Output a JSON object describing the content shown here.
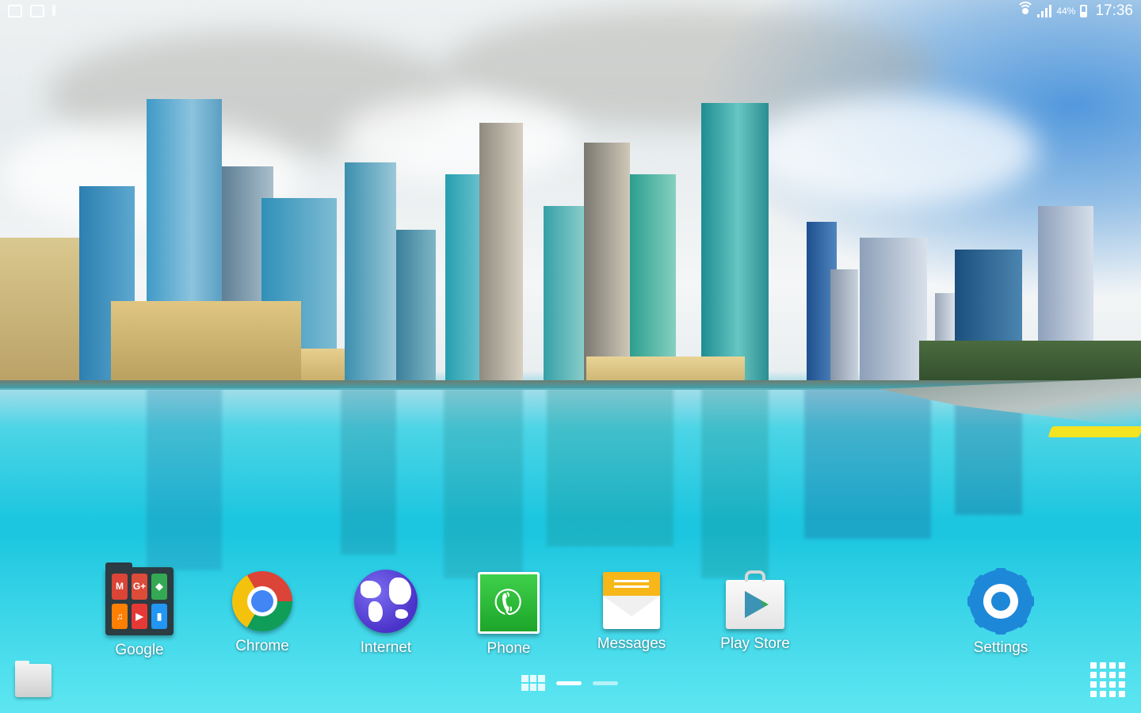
{
  "status_bar": {
    "battery_percent": "44%",
    "time": "17:36"
  },
  "dock": {
    "apps": [
      {
        "label": "Google"
      },
      {
        "label": "Chrome"
      },
      {
        "label": "Internet"
      },
      {
        "label": "Phone"
      },
      {
        "label": "Messages"
      },
      {
        "label": "Play Store"
      },
      {
        "label": "Settings"
      }
    ]
  },
  "google_folder_icons": [
    {
      "name": "gmail-icon",
      "glyph": "M",
      "color": "#db4437"
    },
    {
      "name": "google-plus-icon",
      "glyph": "G+",
      "color": "#dd4b39"
    },
    {
      "name": "maps-icon",
      "glyph": "◆",
      "color": "#34a853"
    },
    {
      "name": "play-music-icon",
      "glyph": "♫",
      "color": "#ff7f00"
    },
    {
      "name": "play-movies-icon",
      "glyph": "▶",
      "color": "#e53935"
    },
    {
      "name": "play-books-icon",
      "glyph": "▮",
      "color": "#2196f3"
    }
  ],
  "pages": {
    "count": 2,
    "active_index": 0
  },
  "colors": {
    "settings_blue": "#1e88d8",
    "phone_green": "#1da52a",
    "messages_yellow": "#f7b718"
  }
}
